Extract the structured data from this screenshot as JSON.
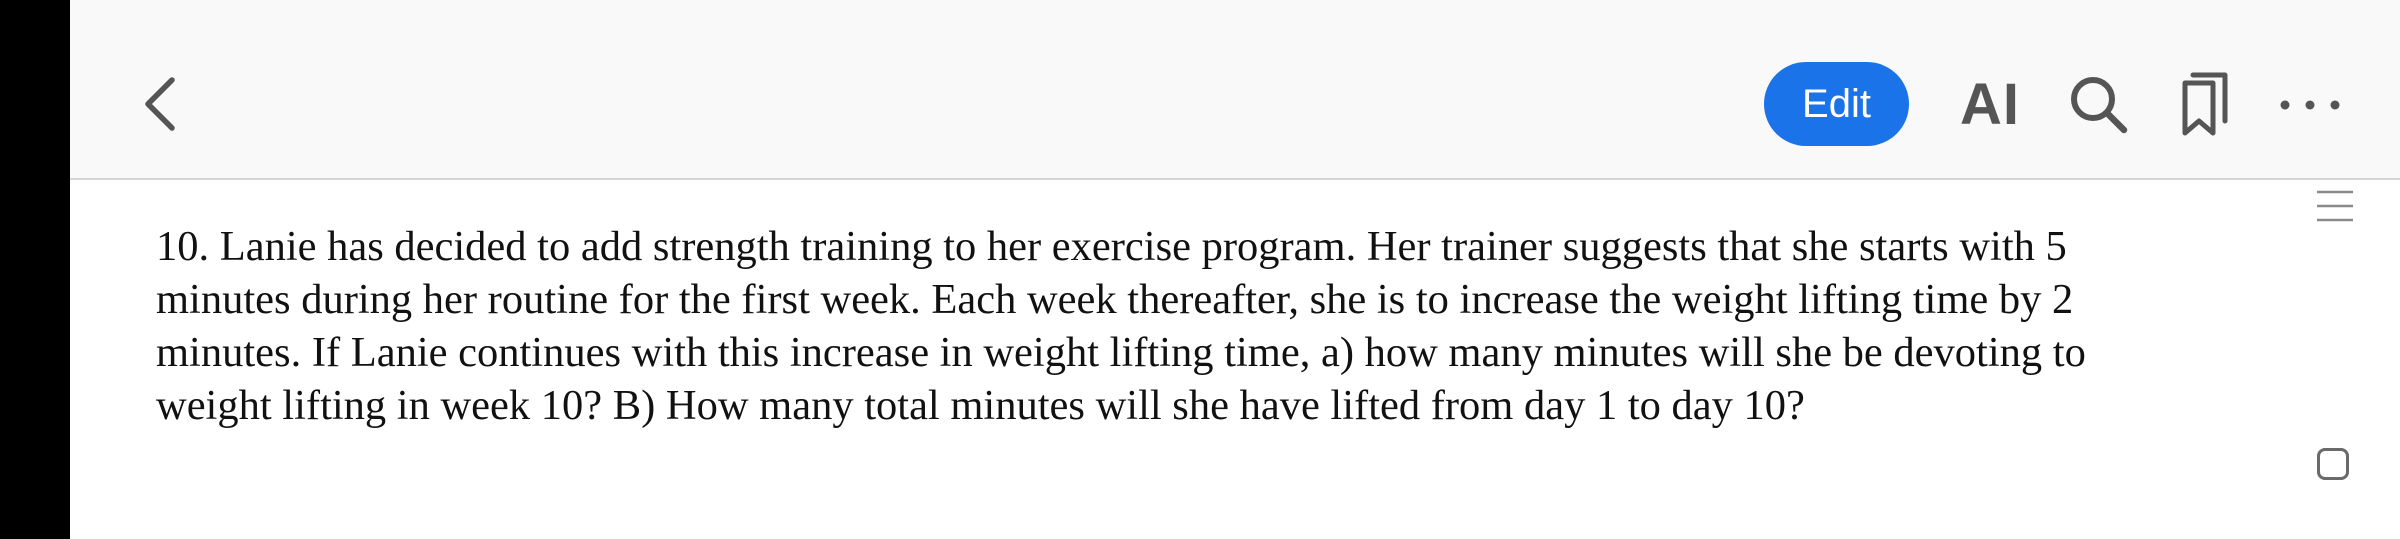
{
  "toolbar": {
    "edit_label": "Edit",
    "ai_label": "AI",
    "icons": {
      "back": "chevron-left-icon",
      "search": "magnifier-icon",
      "bookmark": "bookmark-icon",
      "more": "more-horizontal-icon",
      "menu": "hamburger-icon"
    },
    "accent_color": "#1a73e8"
  },
  "document": {
    "question_text": "10. Lanie has decided to add strength training to her exercise program. Her trainer suggests that she starts with 5\nminutes during her routine for the first week. Each week thereafter, she is to increase the weight lifting time by 2\nminutes. If Lanie continues with this increase in weight lifting time,   a) how many minutes will she be devoting to\nweight lifting in week 10? B) How many total minutes will she have lifted from day 1 to day 10?"
  }
}
